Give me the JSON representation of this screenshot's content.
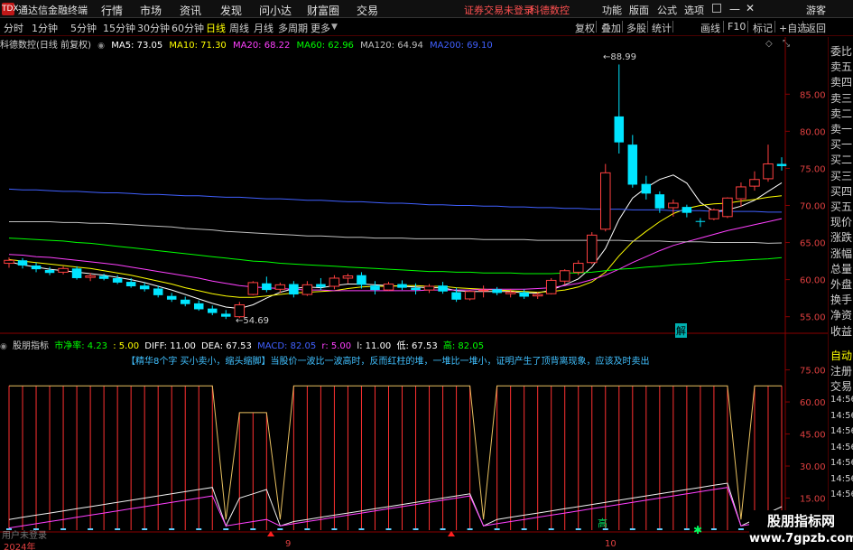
{
  "app": {
    "title": "通达信金融终端",
    "logo": "TDX"
  },
  "menu": [
    "行情",
    "市场",
    "资讯",
    "发现",
    "问小达",
    "财富圈",
    "交易"
  ],
  "warning": "证券交易未登录",
  "stock_name_top": "科德数控",
  "top_right": [
    "功能",
    "版面",
    "公式",
    "选项",
    "游客"
  ],
  "periods": [
    "分时",
    "1分钟",
    "5分钟",
    "15分钟",
    "30分钟",
    "60分钟",
    "日线",
    "周线",
    "月线",
    "多周期",
    "更多"
  ],
  "active_period": "日线",
  "tools": [
    "复权",
    "叠加",
    "多股",
    "统计",
    "画线",
    "F10",
    "标记",
    "+自选",
    "返回"
  ],
  "ma_header": {
    "title": "科德数控(日线 前复权)",
    "ma5": "MA5: 73.05",
    "ma10": "MA10: 71.30",
    "ma20": "MA20: 68.22",
    "ma60": "MA60: 62.96",
    "ma120": "MA120: 64.94",
    "ma200": "MA200: 69.10"
  },
  "indicator_header": {
    "name": "股朋指标",
    "jingshuai": "市净率: 4.23",
    "v2": ": 5.00",
    "diff": "DIFF: 11.00",
    "dea": "DEA: 67.53",
    "macd": "MACD: 82.05",
    "r": "r: 5.00",
    "l": "l: 11.00",
    "low": "低: 67.53",
    "high": "高: 82.05"
  },
  "note": "【精华8个字 买小卖小，缩头缩脚】当股价一波比一波高时，反而红柱的堆，一堆比一堆小，证明产生了顶背离现象，应该及时卖出",
  "price_axis": [
    "85.00",
    "80.00",
    "75.00",
    "70.00",
    "65.00",
    "60.00",
    "55.00"
  ],
  "indicator_axis": [
    "75.00",
    "60.00",
    "45.00",
    "30.00",
    "15.00"
  ],
  "annotations": {
    "high_label": "88.99",
    "low_label": "54.69",
    "jie": "解",
    "gao": "高"
  },
  "x_labels": [
    "2024年",
    "9",
    "10"
  ],
  "right_panel": [
    "委比",
    "卖五",
    "卖四",
    "卖三",
    "卖二",
    "卖一",
    "买一",
    "买二",
    "买三",
    "买四",
    "买五",
    "现价",
    "涨跌",
    "涨幅",
    "总量",
    "外盘",
    "换手",
    "净资",
    "收益"
  ],
  "right_panel_lower": [
    "自动",
    "注册",
    "交易"
  ],
  "right_times": [
    "14:56",
    "14:56",
    "14:56",
    "14:56",
    "14:56",
    "14:56",
    "14:56"
  ],
  "right_top_tag": "KR",
  "footer_hint": "用户未登录",
  "watermark": {
    "line1": "股朋指标网",
    "line2": "www.7gpzb.com"
  },
  "colors": {
    "up": "#ff4040",
    "down": "#00e5ff",
    "ma5": "#ffffff",
    "ma10": "#ffff00",
    "ma20": "#ff40ff",
    "ma60": "#00ff00",
    "ma120": "#c0c0c0",
    "ma200": "#4060ff"
  },
  "chart_data": {
    "type": "candlestick",
    "candles": [
      [
        62.2,
        63.0,
        61.6,
        62.6
      ],
      [
        62.6,
        62.9,
        61.5,
        61.9
      ],
      [
        61.9,
        62.3,
        61.0,
        61.4
      ],
      [
        61.3,
        61.7,
        60.6,
        60.9
      ],
      [
        61.0,
        61.8,
        60.7,
        61.5
      ],
      [
        61.5,
        61.8,
        60.0,
        60.2
      ],
      [
        60.3,
        60.9,
        59.8,
        60.5
      ],
      [
        60.5,
        60.8,
        59.9,
        60.1
      ],
      [
        60.2,
        60.6,
        59.4,
        59.6
      ],
      [
        59.7,
        60.2,
        58.9,
        59.1
      ],
      [
        59.2,
        59.6,
        58.4,
        58.7
      ],
      [
        58.8,
        59.2,
        57.6,
        57.9
      ],
      [
        57.8,
        58.2,
        57.0,
        57.3
      ],
      [
        57.3,
        57.7,
        56.4,
        56.7
      ],
      [
        56.8,
        57.2,
        55.8,
        56.0
      ],
      [
        56.1,
        56.5,
        55.2,
        55.5
      ],
      [
        55.4,
        55.9,
        54.69,
        55.0
      ],
      [
        55.0,
        57.0,
        54.8,
        56.6
      ],
      [
        58.0,
        59.8,
        57.9,
        59.6
      ],
      [
        59.5,
        60.4,
        58.3,
        58.6
      ],
      [
        58.7,
        59.6,
        58.2,
        59.3
      ],
      [
        59.4,
        59.8,
        57.6,
        58.0
      ],
      [
        58.0,
        59.8,
        57.8,
        59.3
      ],
      [
        59.4,
        60.2,
        58.6,
        59.0
      ],
      [
        59.1,
        60.6,
        58.7,
        60.2
      ],
      [
        60.2,
        60.8,
        59.5,
        60.5
      ],
      [
        60.6,
        61.0,
        58.8,
        59.3
      ],
      [
        59.2,
        59.8,
        58.0,
        58.6
      ],
      [
        58.6,
        59.7,
        58.5,
        59.4
      ],
      [
        59.4,
        59.9,
        58.6,
        58.9
      ],
      [
        58.9,
        59.5,
        58.0,
        58.6
      ],
      [
        58.6,
        59.4,
        58.2,
        59.1
      ],
      [
        59.2,
        59.7,
        58.1,
        58.4
      ],
      [
        58.3,
        58.9,
        57.0,
        57.3
      ],
      [
        57.4,
        58.6,
        57.2,
        58.4
      ],
      [
        58.5,
        59.2,
        57.6,
        58.6
      ],
      [
        58.7,
        59.0,
        57.9,
        58.2
      ],
      [
        58.1,
        58.7,
        57.6,
        58.3
      ],
      [
        58.3,
        58.7,
        57.4,
        57.7
      ],
      [
        57.8,
        58.3,
        57.4,
        58.0
      ],
      [
        58.1,
        60.2,
        58.0,
        59.9
      ],
      [
        59.8,
        61.4,
        59.3,
        61.2
      ],
      [
        61.0,
        62.6,
        60.6,
        62.2
      ],
      [
        62.3,
        66.4,
        62.1,
        66.0
      ],
      [
        66.8,
        75.6,
        66.5,
        74.4
      ],
      [
        82.0,
        89.0,
        77.0,
        78.5
      ],
      [
        78.2,
        79.5,
        72.4,
        72.8
      ],
      [
        72.9,
        74.0,
        70.8,
        71.6
      ],
      [
        71.5,
        71.9,
        69.0,
        69.6
      ],
      [
        69.7,
        70.8,
        68.5,
        70.3
      ],
      [
        69.8,
        70.1,
        68.4,
        69.0
      ],
      [
        67.9,
        68.3,
        67.1,
        67.8
      ],
      [
        68.2,
        69.6,
        68.0,
        69.4
      ],
      [
        68.5,
        71.1,
        68.3,
        71.0
      ],
      [
        70.9,
        73.1,
        69.8,
        72.5
      ],
      [
        72.6,
        74.6,
        72.0,
        73.5
      ],
      [
        73.6,
        78.2,
        73.2,
        75.6
      ],
      [
        75.6,
        76.5,
        74.7,
        75.3
      ]
    ],
    "ma_lines": {
      "MA5": [
        62.4,
        62.0,
        61.7,
        61.4,
        61.2,
        61.0,
        60.8,
        60.6,
        60.3,
        60.0,
        59.6,
        59.1,
        58.6,
        58.0,
        57.4,
        56.8,
        56.3,
        56.1,
        56.6,
        57.5,
        58.3,
        58.8,
        59.0,
        58.9,
        59.2,
        59.4,
        59.4,
        59.3,
        59.2,
        59.1,
        59.0,
        58.9,
        58.9,
        58.5,
        58.4,
        58.4,
        58.4,
        58.4,
        58.2,
        58.2,
        58.6,
        59.3,
        60.1,
        61.7,
        64.2,
        68.1,
        71.0,
        72.4,
        73.5,
        74.1,
        73.0,
        70.4,
        69.2,
        69.4,
        69.9,
        70.7,
        71.9,
        73.05
      ],
      "MA10": [
        62.7,
        62.5,
        62.3,
        62.1,
        61.9,
        61.7,
        61.5,
        61.2,
        60.9,
        60.6,
        60.2,
        59.8,
        59.4,
        58.9,
        58.5,
        58.1,
        57.8,
        57.6,
        57.6,
        57.8,
        58.0,
        58.2,
        58.3,
        58.4,
        58.5,
        58.8,
        59.0,
        59.1,
        59.1,
        59.2,
        59.2,
        59.1,
        59.1,
        58.9,
        58.8,
        58.7,
        58.6,
        58.5,
        58.4,
        58.3,
        58.4,
        58.6,
        59.0,
        59.7,
        61.0,
        63.2,
        65.1,
        66.5,
        67.8,
        68.9,
        69.6,
        70.0,
        70.2,
        70.3,
        70.6,
        70.8,
        71.1,
        71.3
      ],
      "MA20": [
        63.4,
        63.3,
        63.1,
        63.0,
        62.8,
        62.6,
        62.4,
        62.2,
        62.0,
        61.7,
        61.4,
        61.1,
        60.8,
        60.5,
        60.2,
        59.8,
        59.5,
        59.2,
        59.0,
        58.9,
        58.8,
        58.7,
        58.6,
        58.6,
        58.5,
        58.5,
        58.5,
        58.5,
        58.5,
        58.5,
        58.5,
        58.6,
        58.6,
        58.6,
        58.6,
        58.7,
        58.7,
        58.7,
        58.7,
        58.8,
        58.9,
        59.2,
        59.5,
        60.0,
        60.6,
        61.4,
        62.3,
        63.1,
        63.9,
        64.6,
        65.1,
        65.6,
        66.1,
        66.6,
        67.0,
        67.4,
        67.8,
        68.22
      ],
      "MA60": [
        65.6,
        65.5,
        65.4,
        65.3,
        65.2,
        65.0,
        64.9,
        64.7,
        64.5,
        64.3,
        64.1,
        63.9,
        63.7,
        63.5,
        63.3,
        63.1,
        62.9,
        62.7,
        62.5,
        62.4,
        62.2,
        62.1,
        62.0,
        61.9,
        61.8,
        61.7,
        61.6,
        61.5,
        61.4,
        61.3,
        61.2,
        61.1,
        61.1,
        61.0,
        61.0,
        60.9,
        60.9,
        60.9,
        60.8,
        60.8,
        60.8,
        60.9,
        60.9,
        61.0,
        61.2,
        61.4,
        61.5,
        61.7,
        61.8,
        62.0,
        62.1,
        62.2,
        62.4,
        62.5,
        62.6,
        62.7,
        62.8,
        62.96
      ],
      "MA120": [
        67.8,
        67.8,
        67.8,
        67.8,
        67.7,
        67.7,
        67.6,
        67.6,
        67.5,
        67.4,
        67.3,
        67.2,
        67.1,
        66.9,
        66.8,
        66.7,
        66.5,
        66.4,
        66.3,
        66.2,
        66.1,
        66.0,
        65.9,
        65.9,
        65.8,
        65.7,
        65.7,
        65.6,
        65.6,
        65.6,
        65.5,
        65.5,
        65.5,
        65.5,
        65.5,
        65.4,
        65.4,
        65.4,
        65.4,
        65.3,
        65.3,
        65.3,
        65.3,
        65.3,
        65.3,
        65.3,
        65.2,
        65.2,
        65.2,
        65.1,
        65.1,
        65.1,
        65.0,
        65.0,
        65.0,
        65.0,
        64.9,
        64.94
      ],
      "MA200": [
        72.2,
        72.1,
        72.1,
        72.0,
        71.9,
        71.9,
        71.8,
        71.7,
        71.7,
        71.6,
        71.5,
        71.5,
        71.4,
        71.3,
        71.3,
        71.2,
        71.1,
        71.1,
        71.0,
        70.9,
        70.9,
        70.8,
        70.7,
        70.7,
        70.6,
        70.5,
        70.5,
        70.4,
        70.3,
        70.3,
        70.2,
        70.1,
        70.1,
        70.0,
        70.0,
        69.9,
        69.9,
        69.8,
        69.8,
        69.7,
        69.7,
        69.6,
        69.6,
        69.5,
        69.5,
        69.5,
        69.4,
        69.4,
        69.4,
        69.3,
        69.3,
        69.3,
        69.2,
        69.2,
        69.2,
        69.2,
        69.1,
        69.1
      ]
    },
    "ylim": [
      53.5,
      91.0
    ],
    "indicator": {
      "ylim": [
        0,
        82
      ],
      "yellow_step": [
        67.5,
        67.5,
        67.5,
        67.5,
        67.5,
        67.5,
        67.5,
        67.5,
        67.5,
        67.5,
        67.5,
        67.5,
        67.5,
        67.5,
        67.5,
        67.5,
        5.0,
        55.0,
        55.0,
        55.0,
        5.0,
        67.5,
        67.5,
        67.5,
        67.5,
        67.5,
        67.5,
        67.5,
        67.5,
        67.5,
        67.5,
        67.5,
        67.5,
        67.5,
        67.5,
        5.0,
        67.5,
        67.5,
        67.5,
        67.5,
        67.5,
        67.5,
        67.5,
        67.5,
        67.5,
        67.5,
        67.5,
        67.5,
        67.5,
        67.5,
        67.5,
        67.5,
        67.5,
        67.5,
        5.0,
        67.5,
        67.5,
        67.5
      ],
      "white_line": [
        5,
        6,
        7,
        8,
        9,
        10,
        11,
        12,
        13,
        14,
        15,
        16,
        17,
        18,
        19,
        20,
        2,
        15,
        17,
        19,
        2,
        4,
        5,
        6,
        7,
        8,
        9,
        10,
        11,
        12,
        13,
        14,
        15,
        16,
        17,
        2,
        5,
        6,
        7,
        8,
        9,
        10,
        11,
        12,
        13,
        14,
        15,
        16,
        17,
        18,
        19,
        20,
        21,
        22,
        2,
        5,
        8,
        11
      ],
      "magenta_line": [
        1,
        2,
        3,
        4,
        5,
        6,
        7,
        8,
        9,
        10,
        11,
        12,
        13,
        14,
        15,
        16,
        2,
        3,
        4,
        5,
        2,
        3,
        4,
        5,
        6,
        7,
        8,
        9,
        10,
        11,
        12,
        13,
        14,
        15,
        16,
        2,
        3,
        4,
        5,
        6,
        7,
        8,
        9,
        10,
        11,
        12,
        13,
        14,
        15,
        16,
        17,
        18,
        19,
        20,
        2,
        3,
        4,
        6
      ]
    }
  }
}
